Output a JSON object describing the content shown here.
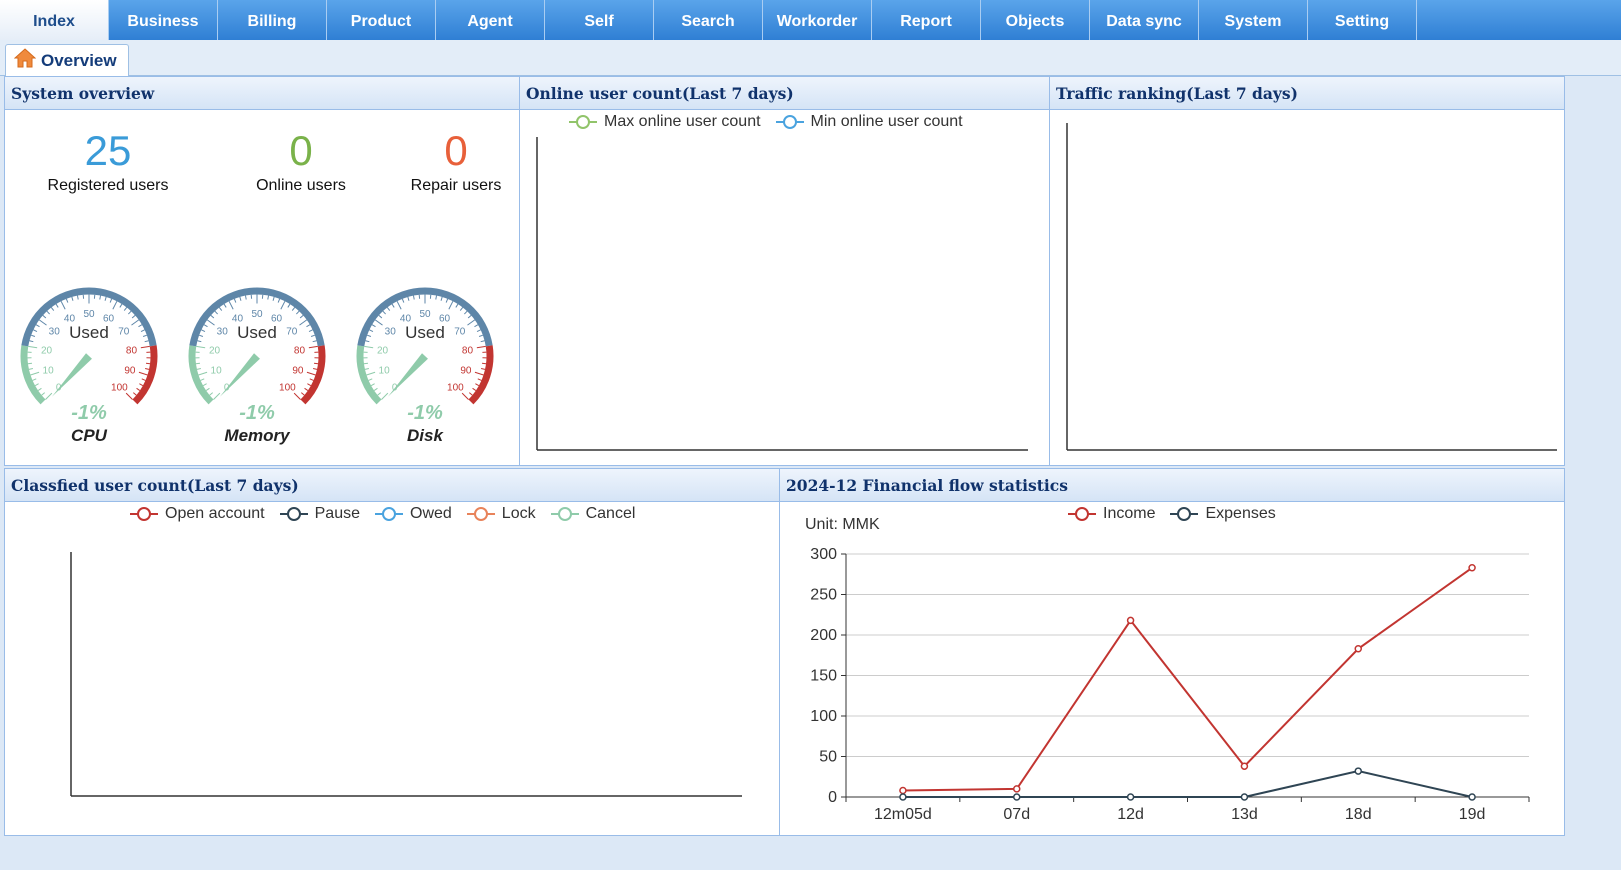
{
  "nav": {
    "items": [
      {
        "label": "Index",
        "active": true
      },
      {
        "label": "Business"
      },
      {
        "label": "Billing"
      },
      {
        "label": "Product"
      },
      {
        "label": "Agent"
      },
      {
        "label": "Self"
      },
      {
        "label": "Search"
      },
      {
        "label": "Workorder"
      },
      {
        "label": "Report"
      },
      {
        "label": "Objects"
      },
      {
        "label": "Data sync"
      },
      {
        "label": "System"
      },
      {
        "label": "Setting"
      }
    ]
  },
  "tab": {
    "label": "Overview",
    "icon": "home-icon"
  },
  "system_overview": {
    "title": "System overview",
    "stats": [
      {
        "value": "25",
        "label": "Registered users",
        "color": "#3a9bd8"
      },
      {
        "value": "0",
        "label": "Online users",
        "color": "#7ab24a"
      },
      {
        "value": "0",
        "label": "Repair users",
        "color": "#e8603a"
      }
    ],
    "gauges": [
      {
        "name": "CPU",
        "center_label": "Used",
        "readout": "-1%",
        "value": -1
      },
      {
        "name": "Memory",
        "center_label": "Used",
        "readout": "-1%",
        "value": -1
      },
      {
        "name": "Disk",
        "center_label": "Used",
        "readout": "-1%",
        "value": -1
      }
    ],
    "gauge_ticks": [
      "0",
      "10",
      "20",
      "30",
      "40",
      "50",
      "60",
      "70",
      "80",
      "90",
      "100"
    ],
    "colors": {
      "low": "#8fcbaa",
      "mid": "#5e86a8",
      "high": "#c23531",
      "readout": "#8fcbaa"
    }
  },
  "online_users": {
    "title": "Online user count(Last 7 days)",
    "legend": [
      {
        "name": "Max online user count",
        "color": "#91c46a"
      },
      {
        "name": "Min online user count",
        "color": "#4aa3df"
      }
    ]
  },
  "traffic": {
    "title": "Traffic ranking(Last 7 days)"
  },
  "classified": {
    "title": "Classfied user count(Last 7 days)",
    "legend": [
      {
        "name": "Open account",
        "color": "#c23531"
      },
      {
        "name": "Pause",
        "color": "#2f4554"
      },
      {
        "name": "Owed",
        "color": "#4aa3df"
      },
      {
        "name": "Lock",
        "color": "#e8835a"
      },
      {
        "name": "Cancel",
        "color": "#8fcbaa"
      }
    ]
  },
  "financial": {
    "title": "2024-12 Financial flow statistics",
    "unit_label": "Unit: MMK"
  },
  "chart_data": {
    "type": "line",
    "title": "2024-12 Financial flow statistics",
    "categories": [
      "12m05d",
      "07d",
      "12d",
      "13d",
      "18d",
      "19d"
    ],
    "ylim": [
      0,
      300
    ],
    "yticks": [
      0,
      50,
      100,
      150,
      200,
      250,
      300
    ],
    "grid": true,
    "legend_position": "top-center",
    "series": [
      {
        "name": "Income",
        "color": "#c23531",
        "values": [
          8,
          10,
          218,
          38,
          183,
          283
        ]
      },
      {
        "name": "Expenses",
        "color": "#2f4554",
        "values": [
          0,
          0,
          0,
          0,
          32,
          0
        ]
      }
    ]
  }
}
